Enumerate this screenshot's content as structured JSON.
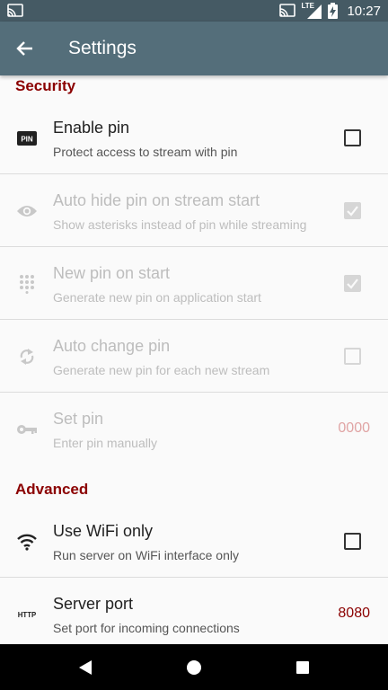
{
  "status_bar": {
    "network_label": "LTE",
    "time": "10:27",
    "icons": [
      "cast-icon",
      "cast-icon",
      "signal-icon",
      "battery-charging-icon"
    ]
  },
  "toolbar": {
    "title": "Settings",
    "back_icon": "arrow-back-icon"
  },
  "sections": {
    "security": {
      "title": "Security",
      "items": [
        {
          "title": "Enable pin",
          "summary": "Protect access to stream with pin",
          "icon": "pin-icon",
          "enabled": true,
          "checked": false
        },
        {
          "title": "Auto hide pin on stream start",
          "summary": "Show asterisks instead of pin while streaming",
          "icon": "eye-icon",
          "enabled": false,
          "checked": true
        },
        {
          "title": "New pin on start",
          "summary": "Generate new pin on application start",
          "icon": "dialpad-icon",
          "enabled": false,
          "checked": true
        },
        {
          "title": "Auto change pin",
          "summary": "Generate new pin for each new stream",
          "icon": "autorenew-icon",
          "enabled": false,
          "checked": false
        },
        {
          "title": "Set pin",
          "summary": "Enter pin manually",
          "icon": "key-icon",
          "enabled": false,
          "value": "0000"
        }
      ]
    },
    "advanced": {
      "title": "Advanced",
      "items": [
        {
          "title": "Use WiFi only",
          "summary": "Run server on WiFi interface only",
          "icon": "wifi-icon",
          "enabled": true,
          "checked": false
        },
        {
          "title": "Server port",
          "summary": "Set port for incoming connections",
          "icon": "http-icon",
          "enabled": true,
          "value": "8080"
        }
      ]
    }
  },
  "colors": {
    "accent": "#8b0000",
    "disabled_value": "#e0a4a4",
    "toolbar": "#546e7a",
    "statusbar": "#455a64"
  },
  "nav_bar": {
    "icons": [
      "back-triangle-icon",
      "home-circle-icon",
      "recents-square-icon"
    ]
  }
}
